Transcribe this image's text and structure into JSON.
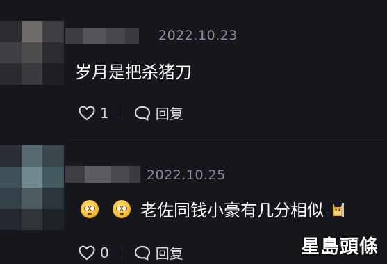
{
  "comments": [
    {
      "date": "2022.10.23",
      "text": "岁月是把杀猪刀",
      "likes": "1",
      "reply_label": "回复"
    },
    {
      "date": "2022.10.25",
      "text": "老佐同钱小豪有几分相似",
      "emoji_prefix": [
        "flushed-face",
        "flushed-face"
      ],
      "emoji_suffix": "cat-icon",
      "likes": "0",
      "reply_label": "回复"
    }
  ],
  "watermark": "星島頭條",
  "colors": {
    "background": "#16171c",
    "date": "#8c8d95",
    "text": "#ffffff",
    "action": "#d9d9dd"
  }
}
